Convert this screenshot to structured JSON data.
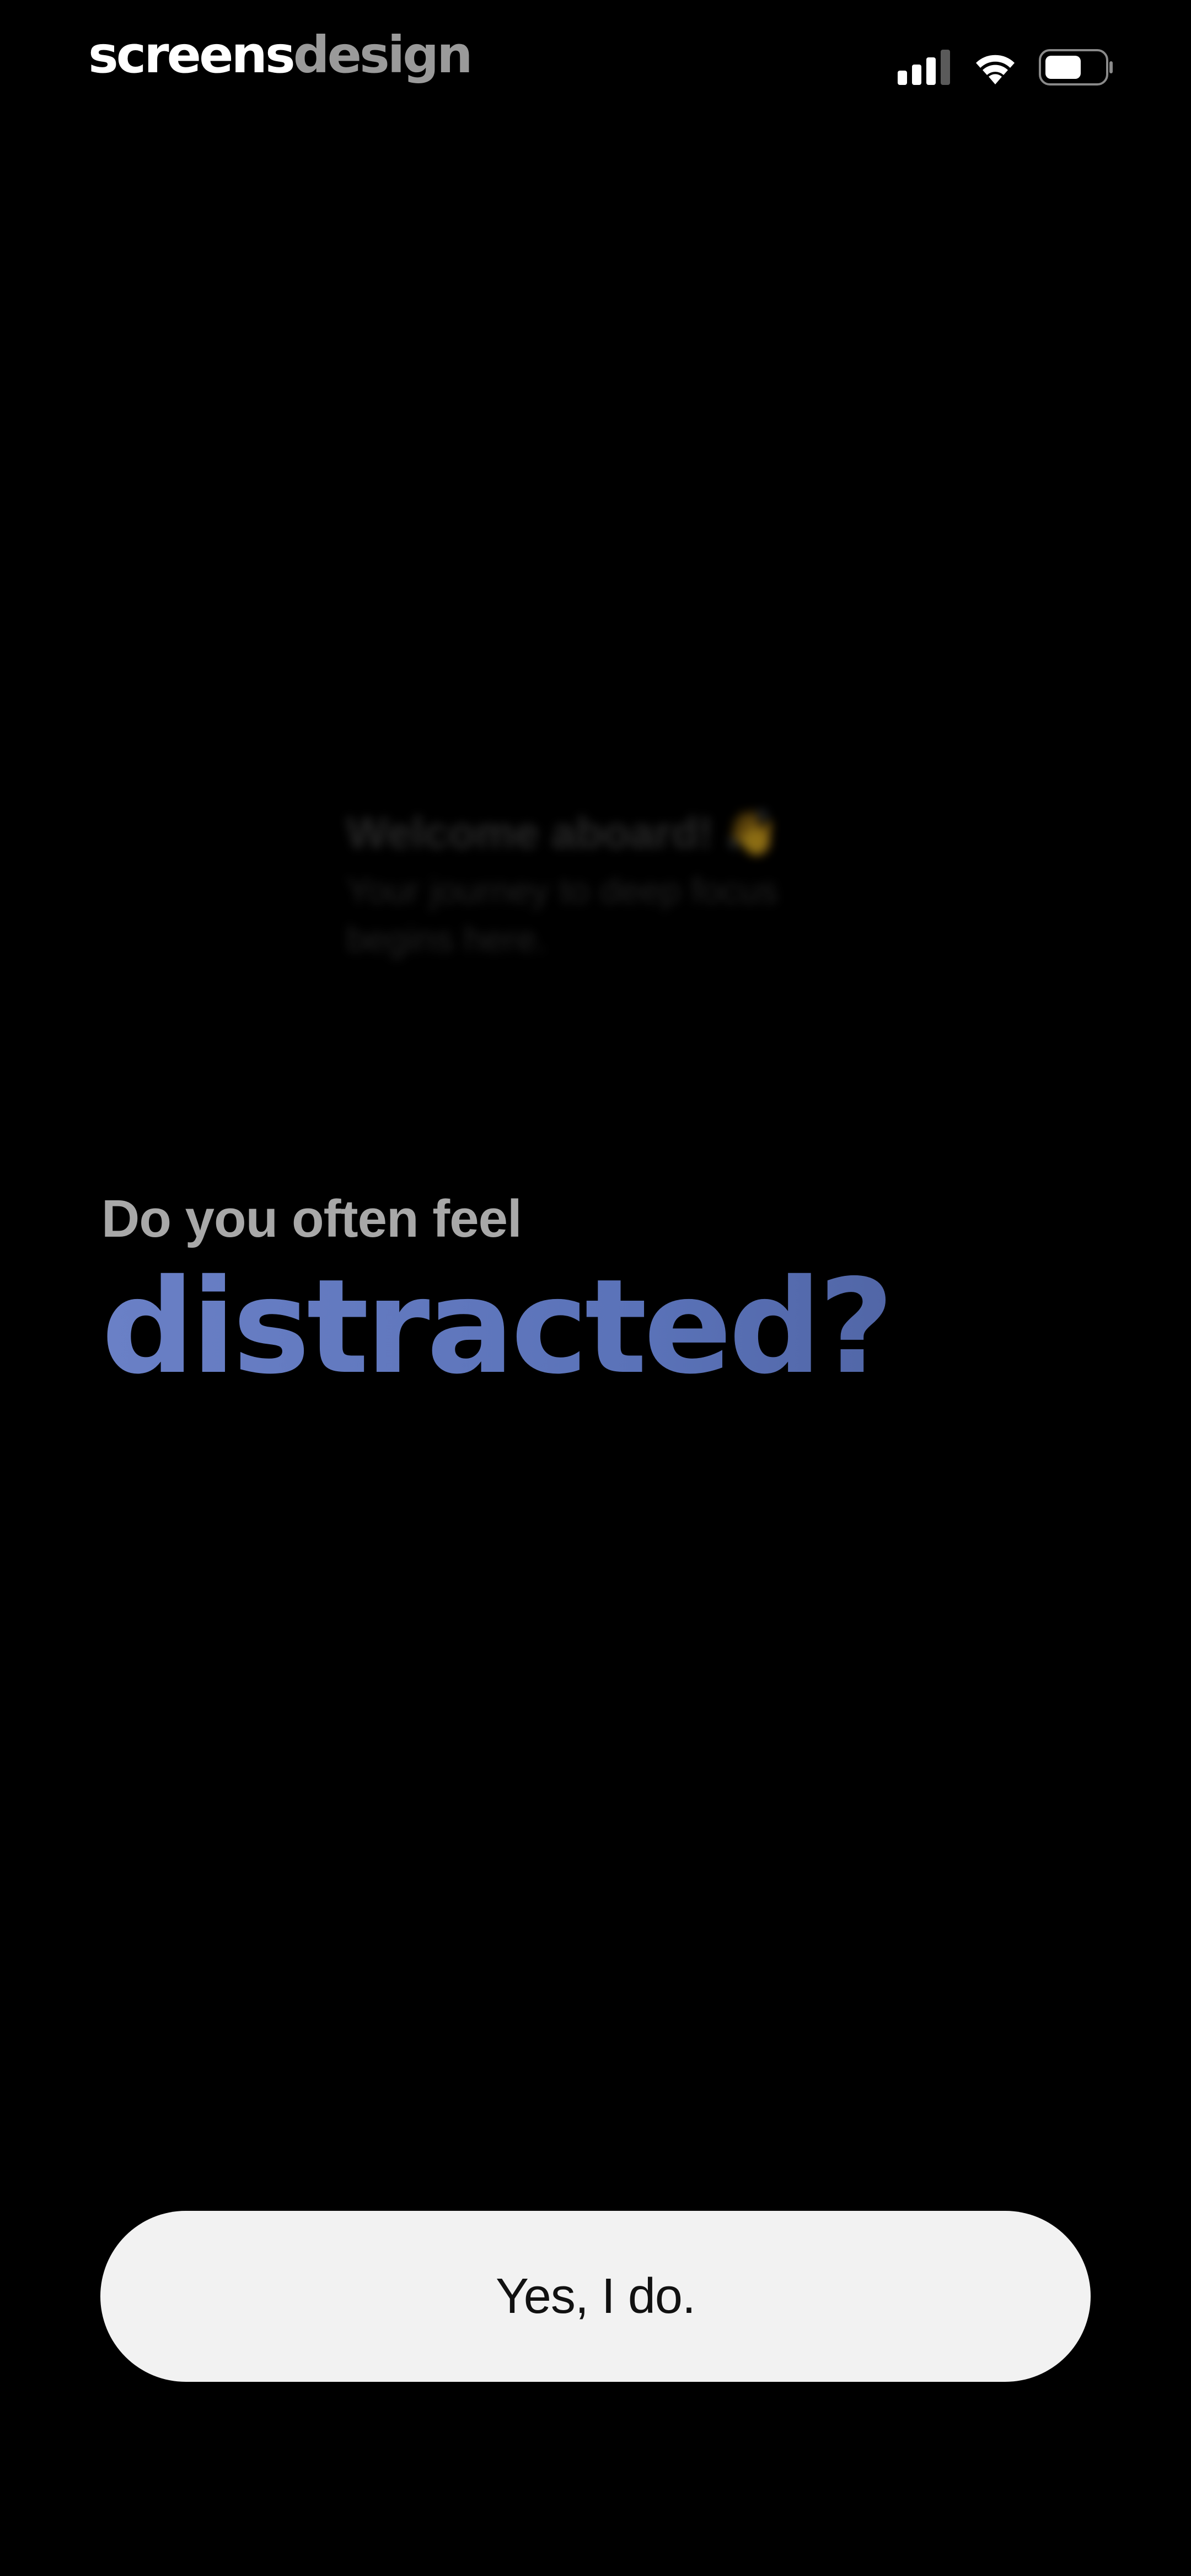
{
  "status_bar": {
    "brand_part1": "screens",
    "brand_part2": "design",
    "icons": [
      "cellular-signal-icon",
      "wifi-icon",
      "battery-icon"
    ]
  },
  "welcome": {
    "title": "Welcome aboard!",
    "emoji": "👋",
    "subtitle_line1": "Your journey to deep focus",
    "subtitle_line2": "begins here."
  },
  "question": {
    "lead": "Do you often feel",
    "emphasis": "distracted?"
  },
  "cta": {
    "label": "Yes, I do."
  },
  "colors": {
    "background": "#000000",
    "emphasis_start": "#6a80c6",
    "emphasis_end": "#4a5c98",
    "button_bg": "#f2f2f2",
    "button_text": "#111111"
  }
}
